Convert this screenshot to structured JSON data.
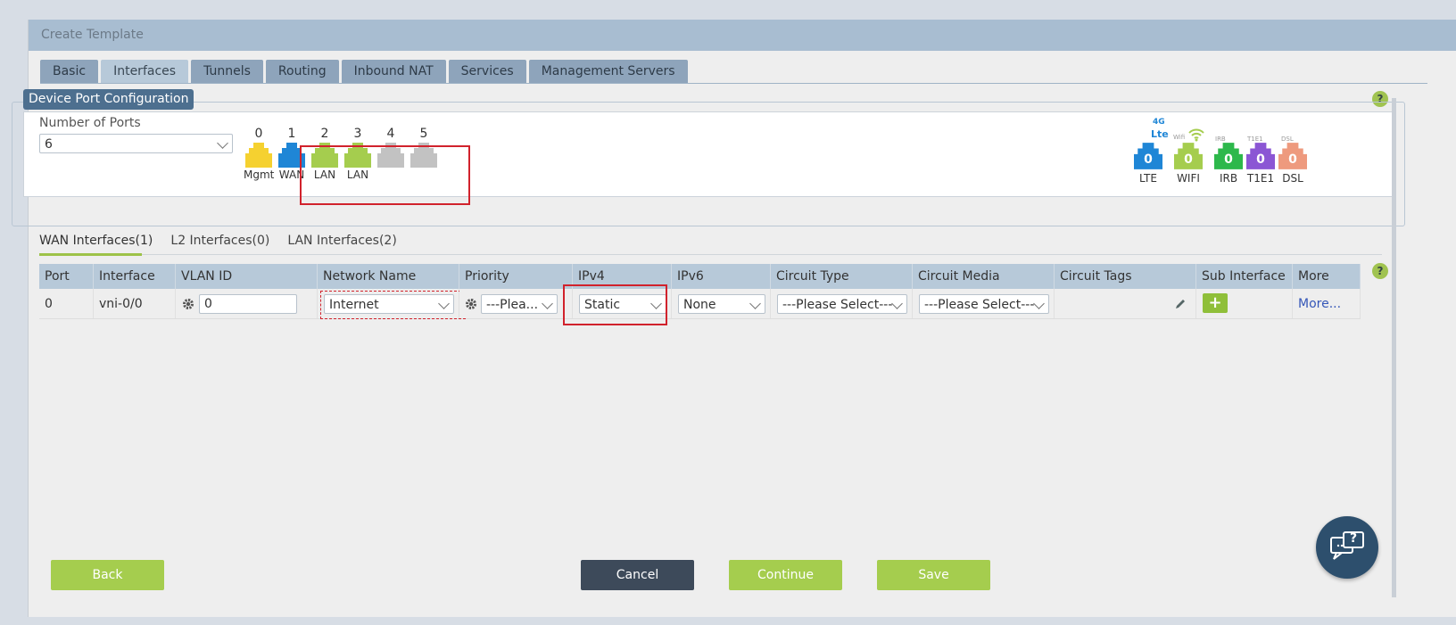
{
  "window": {
    "title": "Create Template"
  },
  "tabs": [
    "Basic",
    "Interfaces",
    "Tunnels",
    "Routing",
    "Inbound NAT",
    "Services",
    "Management Servers"
  ],
  "active_tab": "Interfaces",
  "port_config": {
    "legend": "Device Port Configuration",
    "num_ports_label": "Number of Ports",
    "num_ports_value": "6",
    "ports": [
      {
        "num": "0",
        "label": "Mgmt",
        "color": "#f5d130"
      },
      {
        "num": "1",
        "label": "WAN",
        "color": "#1f86d6"
      },
      {
        "num": "2",
        "label": "LAN",
        "color": "#a5cd4e"
      },
      {
        "num": "3",
        "label": "LAN",
        "color": "#a5cd4e"
      },
      {
        "num": "4",
        "label": "",
        "color": "#c2c2c2"
      },
      {
        "num": "5",
        "label": "",
        "color": "#c2c2c2"
      }
    ],
    "interfaces": [
      {
        "badge": "4G",
        "badge2": "Lte",
        "count": "0",
        "label": "LTE",
        "color": "#1f86d6"
      },
      {
        "badge": "Wifi",
        "count": "0",
        "label": "WIFI",
        "color": "#a5cd4e"
      },
      {
        "badge": "IRB",
        "count": "0",
        "label": "IRB",
        "color": "#2db84b"
      },
      {
        "badge": "T1E1",
        "count": "0",
        "label": "T1E1",
        "color": "#8b56d4"
      },
      {
        "badge": "DSL",
        "count": "0",
        "label": "DSL",
        "color": "#ee9a7e"
      }
    ]
  },
  "subtabs": [
    "WAN Interfaces(1)",
    "L2 Interfaces(0)",
    "LAN Interfaces(2)"
  ],
  "table": {
    "headers": [
      "Port",
      "Interface",
      "VLAN ID",
      "Network Name",
      "Priority",
      "IPv4",
      "IPv6",
      "Circuit Type",
      "Circuit Media",
      "Circuit Tags",
      "Sub Interface",
      "More"
    ],
    "row": {
      "port": "0",
      "interface": "vni-0/0",
      "vlan_id": "0",
      "network_name": "Internet",
      "priority": "---Plea...",
      "ipv4": "Static",
      "ipv6": "None",
      "circuit_type": "---Please Select---",
      "circuit_media": "---Please Select---",
      "more": "More..."
    }
  },
  "buttons": {
    "back": "Back",
    "cancel": "Cancel",
    "continue": "Continue",
    "save": "Save"
  },
  "help_icon": "?",
  "chat_icon": "?",
  "colors": {
    "accent_green": "#a5cd4e",
    "cancel_dark": "#3d4a5a",
    "red_highlight": "#d1222c"
  }
}
